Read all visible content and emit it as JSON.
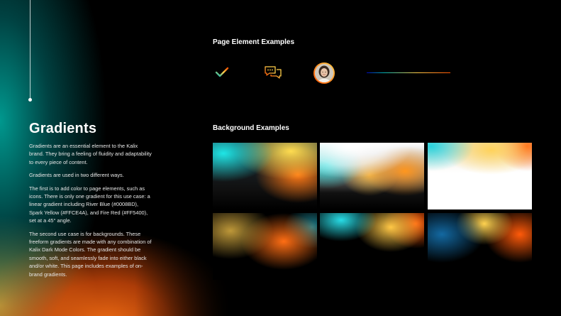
{
  "left": {
    "title": "Gradients",
    "paragraphs": [
      "Gradients are an essential element to the Kalix brand. They bring a feeling of fluidity and adaptability to every piece of content.",
      "Gradients are used in two different ways.",
      "The first is to add color to page elements, such as icons. There is only one gradient for this use case: a linear gradient including River Blue (#0008BD), Spark Yellow (#FFCE4A), and Fire Red (#FF5400), set at a 45° angle.",
      "The second use case is for backgrounds. These freeform gradients are made with any combination of Kalix Dark Mode Colors. The gradient should be smooth, soft, and seamlessly fade into either black and/or white. This page includes examples of on-brand gradients."
    ]
  },
  "page_elements": {
    "label": "Page Element Examples",
    "icons": [
      "check-icon",
      "chat-bubbles-icon",
      "avatar",
      "gradient-line"
    ]
  },
  "backgrounds": {
    "label": "Background Examples"
  },
  "colors": {
    "river_blue": "#0008BD",
    "spark_yellow": "#FFCE4A",
    "fire_red": "#FF5400",
    "background": "#000000"
  }
}
